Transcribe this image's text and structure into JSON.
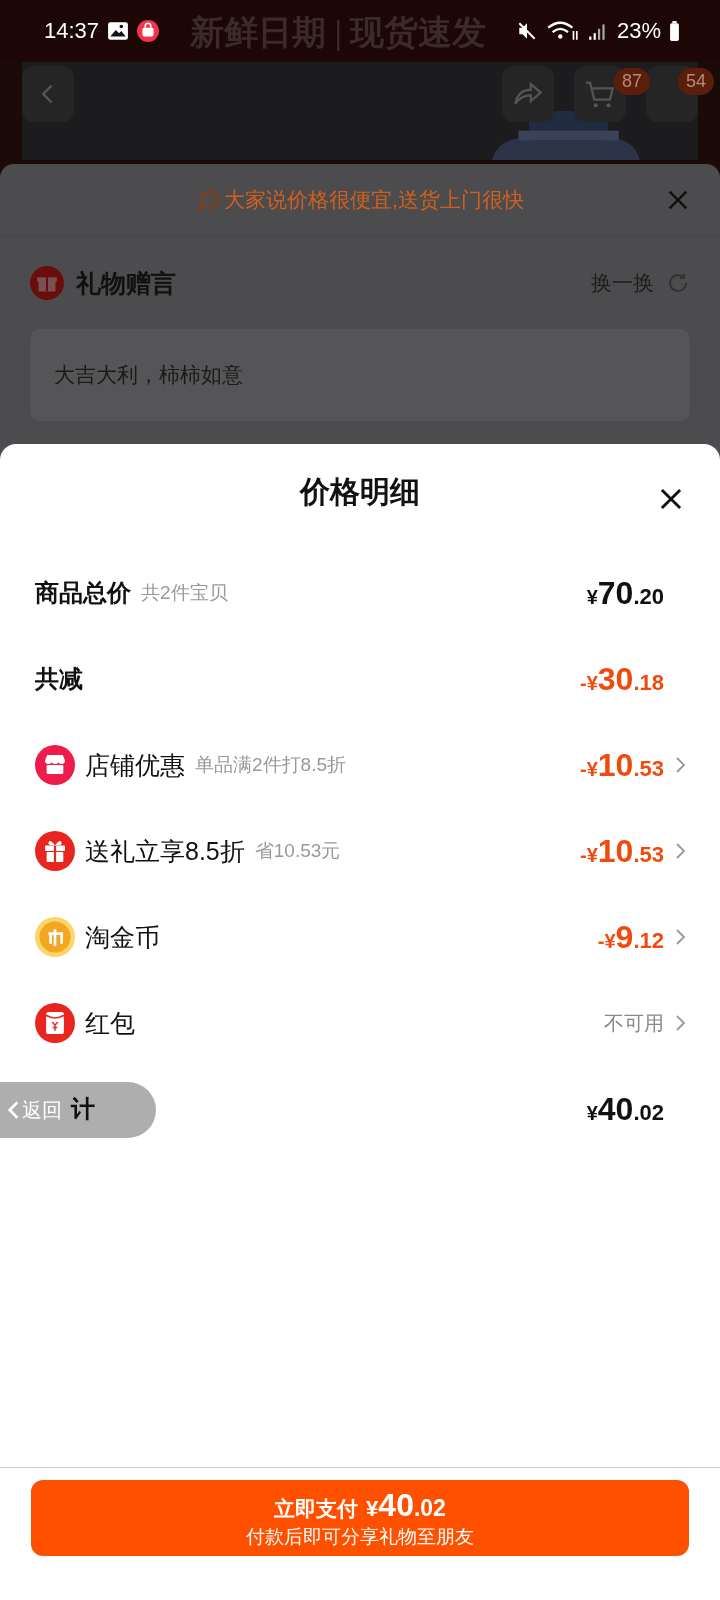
{
  "status_bar": {
    "time": "14:37",
    "battery": "23%"
  },
  "background": {
    "banner_text": "新鲜日期 | 现货速发",
    "cart_badge": "87",
    "more_badge": "54",
    "gift_sheet": {
      "tip": "大家说价格很便宜,送货上门很快",
      "title": "礼物赠言",
      "refresh": "换一换",
      "message": "大吉大利，柿柿如意"
    }
  },
  "price_sheet": {
    "title": "价格明细",
    "subtotal": {
      "label": "商品总价",
      "note": "共2件宝贝",
      "prefix": "¥",
      "main": "70",
      "fraction": ".20"
    },
    "discount_total": {
      "label": "共减",
      "prefix": "-¥",
      "main": "30",
      "fraction": ".18"
    },
    "items": [
      {
        "kind": "store",
        "label": "店铺优惠",
        "note": "单品满2件打8.5折",
        "prefix": "-¥",
        "main": "10",
        "fraction": ".53"
      },
      {
        "kind": "gift",
        "label": "送礼立享8.5折",
        "note": "省10.53元",
        "prefix": "-¥",
        "main": "10",
        "fraction": ".53"
      },
      {
        "kind": "coin",
        "label": "淘金币",
        "prefix": "-¥",
        "main": "9",
        "fraction": ".12"
      },
      {
        "kind": "red_packet",
        "label": "红包",
        "status": "不可用"
      }
    ],
    "total": {
      "label": "计",
      "prefix": "¥",
      "main": "40",
      "fraction": ".02"
    },
    "pay_button": {
      "label": "立即支付",
      "prefix": "¥",
      "main": "40",
      "fraction": ".02",
      "note": "付款后即可分享礼物至朋友"
    }
  },
  "back_button": {
    "label": "返回"
  }
}
